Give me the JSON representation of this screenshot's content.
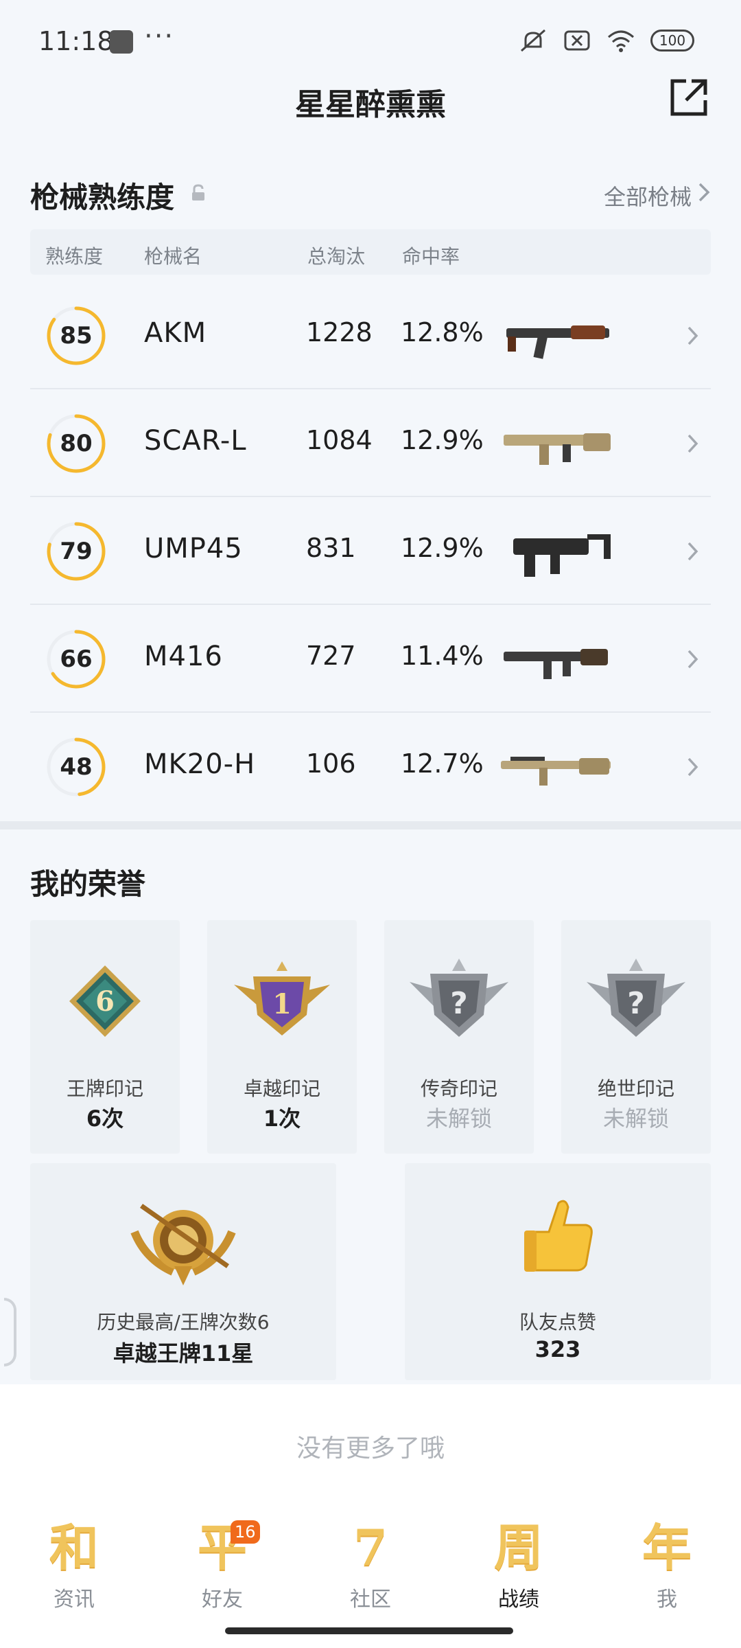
{
  "status": {
    "time": "11:18",
    "dots": "···",
    "battery": "100",
    "wifi_sub": "6"
  },
  "header": {
    "title": "星星醉熏熏"
  },
  "guns": {
    "title": "枪械熟练度",
    "all_label": "全部枪械",
    "columns": [
      "熟练度",
      "枪械名",
      "总淘汰",
      "命中率"
    ],
    "rows": [
      {
        "mastery": "85",
        "mastery_pct": 0.85,
        "name": "AKM",
        "kills": "1228",
        "rate": "12.8%",
        "weapon_icon": "akm-rifle-icon"
      },
      {
        "mastery": "80",
        "mastery_pct": 0.8,
        "name": "SCAR-L",
        "kills": "1084",
        "rate": "12.9%",
        "weapon_icon": "scar-rifle-icon"
      },
      {
        "mastery": "79",
        "mastery_pct": 0.79,
        "name": "UMP45",
        "kills": "831",
        "rate": "12.9%",
        "weapon_icon": "ump-smg-icon"
      },
      {
        "mastery": "66",
        "mastery_pct": 0.66,
        "name": "M416",
        "kills": "727",
        "rate": "11.4%",
        "weapon_icon": "m416-rifle-icon"
      },
      {
        "mastery": "48",
        "mastery_pct": 0.48,
        "name": "MK20-H",
        "kills": "106",
        "rate": "12.7%",
        "weapon_icon": "mk20-rifle-icon"
      }
    ]
  },
  "honors": {
    "title": "我的荣誉",
    "marks": [
      {
        "label": "王牌印记",
        "value": "6次",
        "muted": false,
        "badge_text": "6",
        "icon": "ace-mark-badge-icon"
      },
      {
        "label": "卓越印记",
        "value": "1次",
        "muted": false,
        "badge_text": "1",
        "icon": "excellence-mark-badge-icon"
      },
      {
        "label": "传奇印记",
        "value": "未解锁",
        "muted": true,
        "badge_text": "?",
        "icon": "legend-mark-locked-icon"
      },
      {
        "label": "绝世印记",
        "value": "未解锁",
        "muted": true,
        "badge_text": "?",
        "icon": "peerless-mark-locked-icon"
      }
    ],
    "highest": {
      "label": "历史最高/王牌次数6",
      "value": "卓越王牌11星",
      "icon": "rank-emblem-icon"
    },
    "likes": {
      "label": "队友点赞",
      "value": "323",
      "icon": "thumbs-up-icon"
    }
  },
  "footer_note": "没有更多了哦",
  "nav": [
    {
      "glyph": "和",
      "label": "资讯",
      "active": false,
      "badge": ""
    },
    {
      "glyph": "平",
      "label": "好友",
      "active": false,
      "badge": "16"
    },
    {
      "glyph": "7",
      "label": "社区",
      "active": false,
      "badge": ""
    },
    {
      "glyph": "周",
      "label": "战绩",
      "active": true,
      "badge": ""
    },
    {
      "glyph": "年",
      "label": "我",
      "active": false,
      "badge": ""
    }
  ],
  "colors": {
    "accent": "#f5b82e",
    "ring_track": "#ebeef2",
    "background": "#f4f7fb"
  }
}
